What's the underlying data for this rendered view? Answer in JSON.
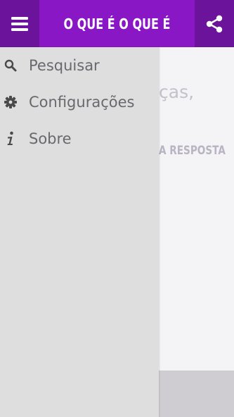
{
  "app_bar": {
    "title": "O QUE É O QUE É",
    "menu_icon": "hamburger-menu-icon",
    "share_icon": "share-icon",
    "color": "#8a17c5",
    "button_color": "#6c139b"
  },
  "background_content": {
    "partial_text_1": "ças,",
    "partial_text_2": "A RESPOSTA"
  },
  "drawer": {
    "items": [
      {
        "label": "Pesquisar",
        "icon": "search-icon"
      },
      {
        "label": "Configurações",
        "icon": "gear-icon"
      },
      {
        "label": "Sobre",
        "icon": "info-icon"
      }
    ]
  }
}
